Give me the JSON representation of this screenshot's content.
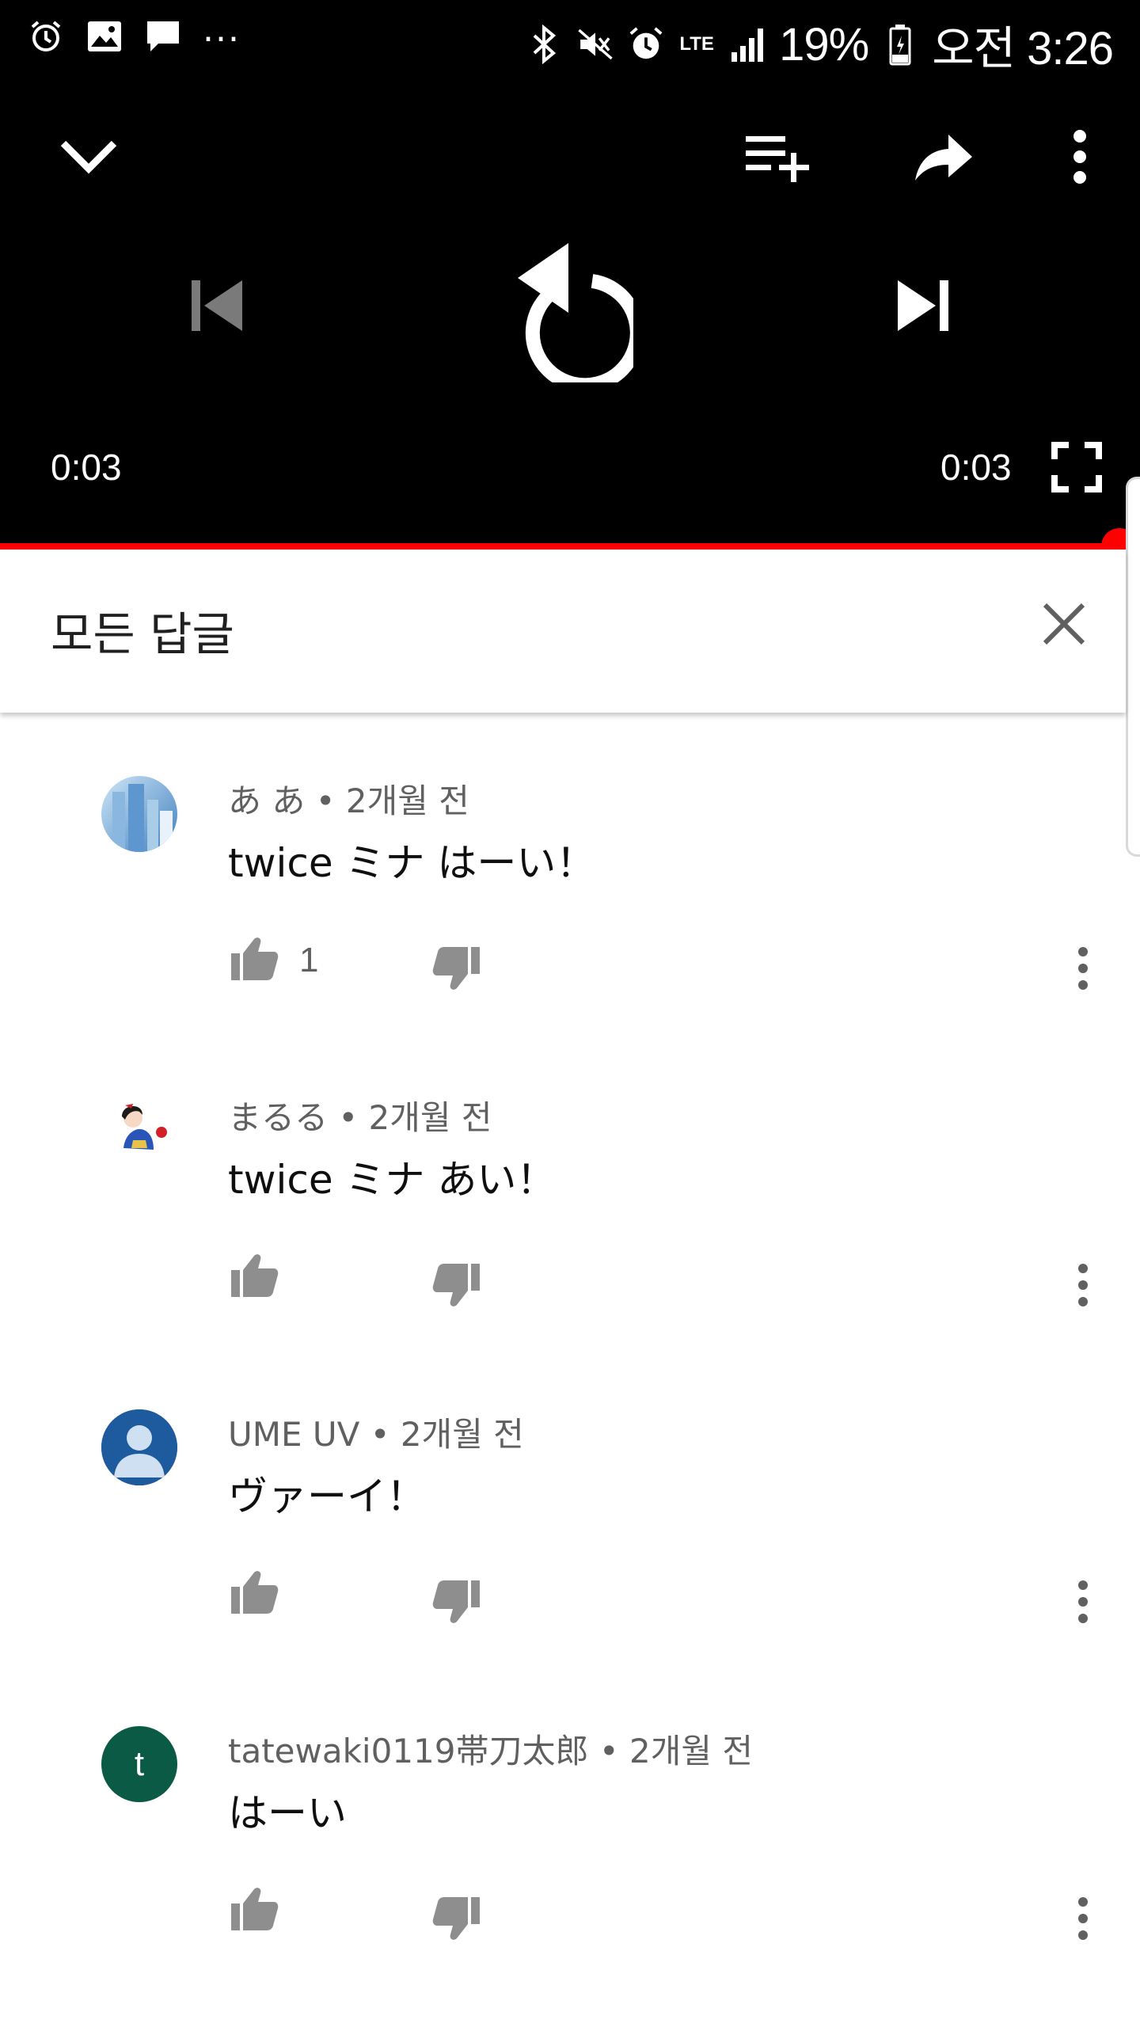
{
  "status_bar": {
    "left_icons": [
      "alarm-icon",
      "image-icon",
      "message-icon"
    ],
    "overflow": "...",
    "right_icons": [
      "bluetooth-icon",
      "mute-icon",
      "alarm-icon",
      "lte-icon",
      "signal-icon",
      "battery-icon"
    ],
    "network": "LTE",
    "battery_percent": "19%",
    "time": "오전 3:26"
  },
  "player": {
    "top_icons": [
      "chevron-down-icon",
      "add-to-playlist-icon",
      "share-icon",
      "more-vert-icon"
    ],
    "playback_icons": [
      "previous-icon",
      "replay-icon",
      "next-icon"
    ],
    "current_time": "0:03",
    "total_time": "0:03",
    "progress": 1.0,
    "accent_color": "#ff0000"
  },
  "panel": {
    "title": "모든 답글",
    "close_icon": "close-icon"
  },
  "comments": [
    {
      "author": "あ あ",
      "age": "2개월 전",
      "text": "twice ミナ はーい！",
      "likes": "1",
      "avatar": "photo-avatar"
    },
    {
      "author": "まるる",
      "age": "2개월 전",
      "text": "twice ミナ あい！",
      "likes": "",
      "avatar": "character-avatar"
    },
    {
      "author": "UME UV",
      "age": "2개월 전",
      "text": "ヴァーイ！",
      "likes": "",
      "avatar": "default-person-avatar"
    },
    {
      "author": "tatewaki0119帯刀太郎",
      "age": "2개월 전",
      "text": "はーい",
      "likes": "",
      "avatar": "letter-avatar",
      "avatar_letter": "t",
      "avatar_color": "#0b5a45"
    }
  ],
  "separator": " • "
}
